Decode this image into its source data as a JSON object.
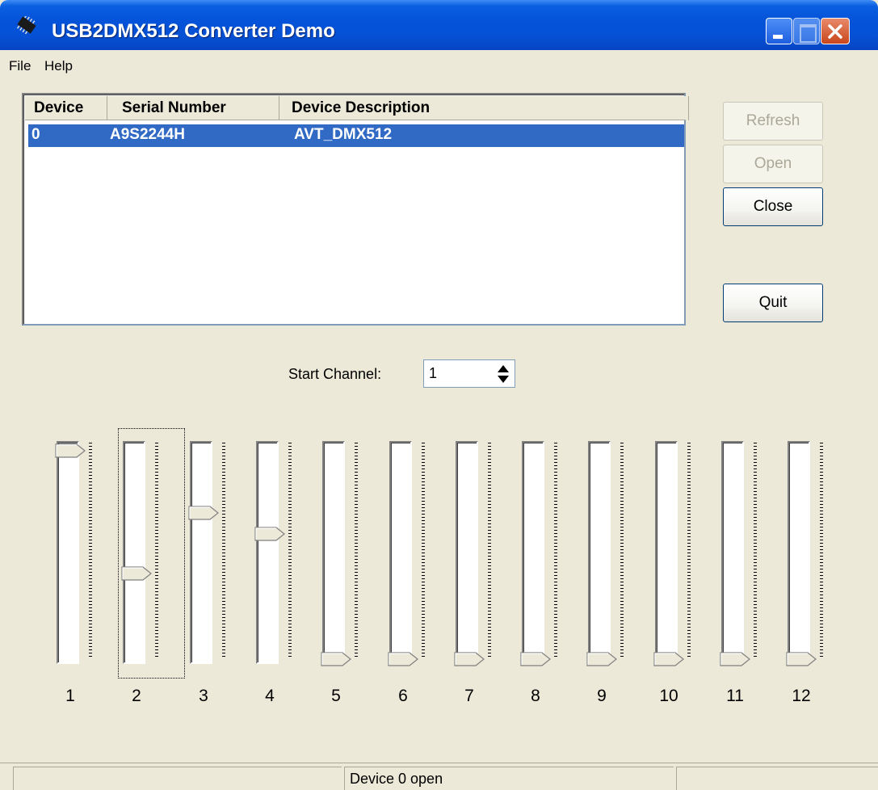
{
  "window": {
    "title": "USB2DMX512 Converter Demo",
    "controls": [
      "minimize-icon",
      "maximize-icon",
      "close-icon"
    ]
  },
  "menu": {
    "file": "File",
    "help": "Help"
  },
  "device_list": {
    "columns": [
      "Device",
      "Serial Number",
      "Device Description"
    ],
    "rows": [
      {
        "device": "0",
        "serial": "A9S2244H",
        "description": "AVT_DMX512",
        "selected": true
      }
    ]
  },
  "buttons": {
    "refresh": "Refresh",
    "open": "Open",
    "close": "Close",
    "quit": "Quit"
  },
  "start_channel": {
    "label": "Start Channel:",
    "value": "1"
  },
  "channels": [
    {
      "label": "1",
      "level": 1.0
    },
    {
      "label": "2",
      "level": 0.41
    },
    {
      "label": "3",
      "level": 0.7
    },
    {
      "label": "4",
      "level": 0.6
    },
    {
      "label": "5",
      "level": 0.0
    },
    {
      "label": "6",
      "level": 0.0
    },
    {
      "label": "7",
      "level": 0.0
    },
    {
      "label": "8",
      "level": 0.0
    },
    {
      "label": "9",
      "level": 0.0
    },
    {
      "label": "10",
      "level": 0.0
    },
    {
      "label": "11",
      "level": 0.0
    },
    {
      "label": "12",
      "level": 0.0
    }
  ],
  "status": {
    "left": "",
    "middle": "Device 0 open",
    "right": ""
  },
  "colors": {
    "titlebar": "#0453d9",
    "selection": "#316ac5",
    "face": "#ece9d8"
  }
}
